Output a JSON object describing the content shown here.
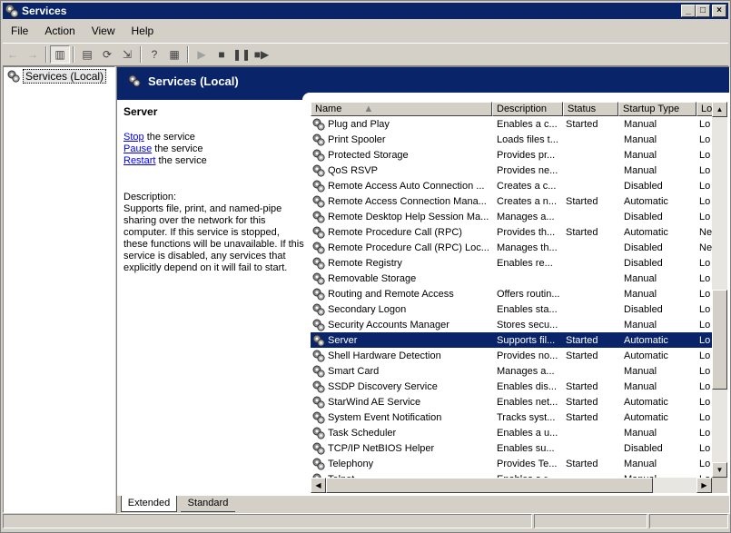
{
  "window": {
    "title": "Services",
    "minimize": "_",
    "maximize": "□",
    "close": "×"
  },
  "menu": [
    "File",
    "Action",
    "View",
    "Help"
  ],
  "toolbar": {
    "back": "←",
    "forward": "→",
    "show_hide_tree": "▥",
    "properties": "▤",
    "refresh": "⟳",
    "export": "⇲",
    "help": "?",
    "console_tree": "▦",
    "start": "▶",
    "stop": "■",
    "pause": "❚❚",
    "restart": "■▶"
  },
  "tree": {
    "root": "Services (Local)"
  },
  "banner": {
    "title": "Services (Local)"
  },
  "detail": {
    "selected_service": "Server",
    "actions": [
      {
        "link": "Stop",
        "rest": " the service"
      },
      {
        "link": "Pause",
        "rest": " the service"
      },
      {
        "link": "Restart",
        "rest": " the service"
      }
    ],
    "description_label": "Description:",
    "description_text": "Supports file, print, and named-pipe sharing over the network for this computer. If this service is stopped, these functions will be unavailable. If this service is disabled, any services that explicitly depend on it will fail to start."
  },
  "columns": [
    "Name",
    "Description",
    "Status",
    "Startup Type",
    "Lo"
  ],
  "rows": [
    {
      "name": "Plug and Play",
      "desc": "Enables a c...",
      "status": "Started",
      "startup": "Manual",
      "logon": "Lo"
    },
    {
      "name": "Print Spooler",
      "desc": "Loads files t...",
      "status": "",
      "startup": "Manual",
      "logon": "Lo"
    },
    {
      "name": "Protected Storage",
      "desc": "Provides pr...",
      "status": "",
      "startup": "Manual",
      "logon": "Lo"
    },
    {
      "name": "QoS RSVP",
      "desc": "Provides ne...",
      "status": "",
      "startup": "Manual",
      "logon": "Lo"
    },
    {
      "name": "Remote Access Auto Connection ...",
      "desc": "Creates a c...",
      "status": "",
      "startup": "Disabled",
      "logon": "Lo"
    },
    {
      "name": "Remote Access Connection Mana...",
      "desc": "Creates a n...",
      "status": "Started",
      "startup": "Automatic",
      "logon": "Lo"
    },
    {
      "name": "Remote Desktop Help Session Ma...",
      "desc": "Manages a...",
      "status": "",
      "startup": "Disabled",
      "logon": "Lo"
    },
    {
      "name": "Remote Procedure Call (RPC)",
      "desc": "Provides th...",
      "status": "Started",
      "startup": "Automatic",
      "logon": "Ne"
    },
    {
      "name": "Remote Procedure Call (RPC) Loc...",
      "desc": "Manages th...",
      "status": "",
      "startup": "Disabled",
      "logon": "Ne"
    },
    {
      "name": "Remote Registry",
      "desc": "Enables re...",
      "status": "",
      "startup": "Disabled",
      "logon": "Lo"
    },
    {
      "name": "Removable Storage",
      "desc": "",
      "status": "",
      "startup": "Manual",
      "logon": "Lo"
    },
    {
      "name": "Routing and Remote Access",
      "desc": "Offers routin...",
      "status": "",
      "startup": "Manual",
      "logon": "Lo"
    },
    {
      "name": "Secondary Logon",
      "desc": "Enables sta...",
      "status": "",
      "startup": "Disabled",
      "logon": "Lo"
    },
    {
      "name": "Security Accounts Manager",
      "desc": "Stores secu...",
      "status": "",
      "startup": "Manual",
      "logon": "Lo"
    },
    {
      "name": "Server",
      "desc": "Supports fil...",
      "status": "Started",
      "startup": "Automatic",
      "logon": "Lo",
      "selected": true
    },
    {
      "name": "Shell Hardware Detection",
      "desc": "Provides no...",
      "status": "Started",
      "startup": "Automatic",
      "logon": "Lo"
    },
    {
      "name": "Smart Card",
      "desc": "Manages a...",
      "status": "",
      "startup": "Manual",
      "logon": "Lo"
    },
    {
      "name": "SSDP Discovery Service",
      "desc": "Enables dis...",
      "status": "Started",
      "startup": "Manual",
      "logon": "Lo"
    },
    {
      "name": "StarWind AE Service",
      "desc": "Enables net...",
      "status": "Started",
      "startup": "Automatic",
      "logon": "Lo"
    },
    {
      "name": "System Event Notification",
      "desc": "Tracks syst...",
      "status": "Started",
      "startup": "Automatic",
      "logon": "Lo"
    },
    {
      "name": "Task Scheduler",
      "desc": "Enables a u...",
      "status": "",
      "startup": "Manual",
      "logon": "Lo"
    },
    {
      "name": "TCP/IP NetBIOS Helper",
      "desc": "Enables su...",
      "status": "",
      "startup": "Disabled",
      "logon": "Lo"
    },
    {
      "name": "Telephony",
      "desc": "Provides Te...",
      "status": "Started",
      "startup": "Manual",
      "logon": "Lo"
    },
    {
      "name": "Telnet",
      "desc": "Enables a r...",
      "status": "",
      "startup": "Manual",
      "logon": "Lo"
    }
  ],
  "scroll": {
    "up": "▲",
    "down": "▼",
    "left": "◀",
    "right": "▶"
  },
  "tabs": {
    "extended": "Extended",
    "standard": "Standard"
  },
  "colors": {
    "selection": "#0a246a",
    "banner": "#0a246a",
    "link": "#0000ff",
    "face": "#d4d0c8"
  }
}
